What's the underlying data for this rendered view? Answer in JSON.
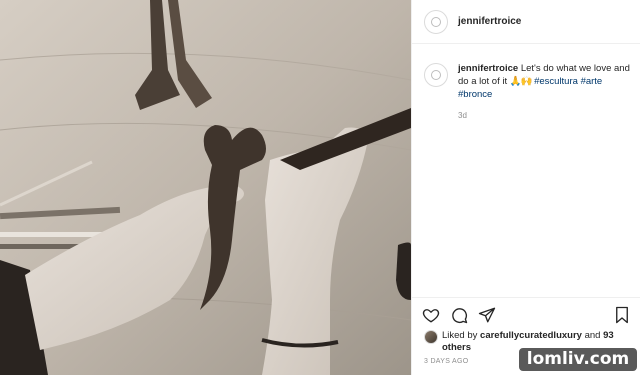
{
  "post": {
    "author": "jennifertroice",
    "caption": {
      "username": "jennifertroice",
      "text": "Let's do what we love and do a lot of it",
      "emoji": "🙏🙌",
      "hashtags": [
        "#escultura",
        "#arte",
        "#bronce"
      ],
      "age": "3d"
    },
    "likes": {
      "prefix": "Liked by",
      "user": "carefullycuratedluxury",
      "conjunction": "and",
      "others": "93 others"
    },
    "date": "3 DAYS AGO",
    "actions": [
      "heart-icon",
      "comment-icon",
      "share-icon",
      "bookmark-icon"
    ]
  },
  "watermark": "lomliv.com"
}
